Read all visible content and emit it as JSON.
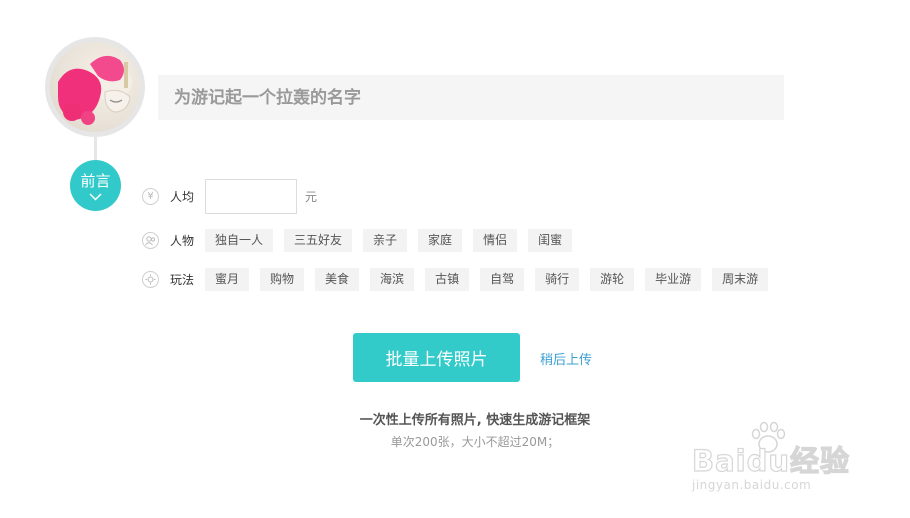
{
  "header": {
    "title_placeholder": "为游记起一个拉轰的名字"
  },
  "preface": {
    "label": "前言",
    "chevron_icon": "chevron-down-icon"
  },
  "budget": {
    "icon": "yen-icon",
    "label": "人均",
    "value": "",
    "unit": "元"
  },
  "people": {
    "icon": "people-icon",
    "label": "人物",
    "tags": [
      "独自一人",
      "三五好友",
      "亲子",
      "家庭",
      "情侣",
      "闺蜜"
    ]
  },
  "activities": {
    "icon": "compass-icon",
    "label": "玩法",
    "tags": [
      "蜜月",
      "购物",
      "美食",
      "海滨",
      "古镇",
      "自驾",
      "骑行",
      "游轮",
      "毕业游",
      "周末游"
    ]
  },
  "upload": {
    "button_label": "批量上传照片",
    "later_label": "稍后上传",
    "tip_main": "一次性上传所有照片, 快速生成游记框架",
    "tip_sub": "单次200张，大小不超过20M；"
  },
  "watermark": {
    "brand": "Baidu经验",
    "url": "jingyan.baidu.com"
  },
  "colors": {
    "accent": "#33caca",
    "link": "#3a9fd0",
    "tag_bg": "#f3f3f3"
  }
}
